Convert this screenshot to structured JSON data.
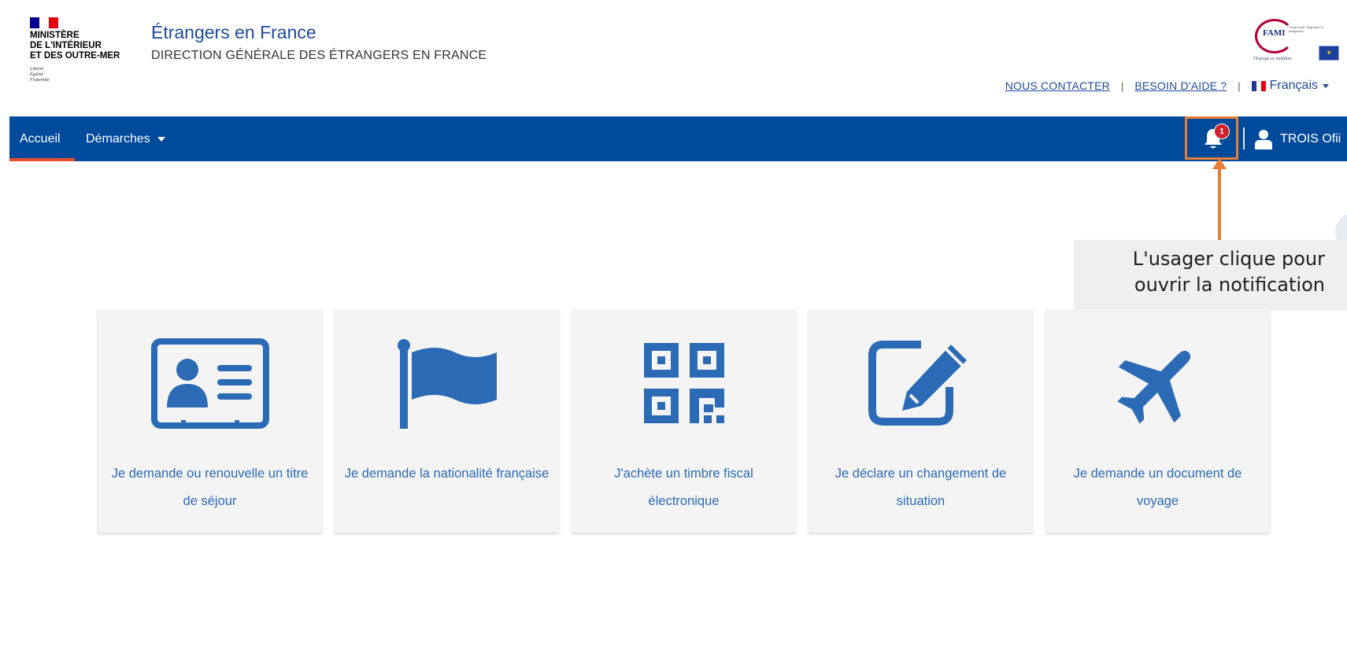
{
  "header": {
    "ministry": "MINISTÈRE\nDE L'INTÉRIEUR\nET DES OUTRE-MER",
    "motto": "Liberté\nÉgalité\nFraternité",
    "site_title": "Étrangers en France",
    "site_subtitle": "DIRECTION GÉNÉRALE DES ÉTRANGERS EN FRANCE",
    "fami": {
      "name": "FAMI",
      "desc": "Fonds Asile, Migration et Intégration",
      "tagline": "l'Europe se mobilise"
    },
    "links": {
      "contact": "NOUS CONTACTER",
      "help": "BESOIN D'AIDE ?",
      "separator": "|"
    },
    "language": "Français"
  },
  "nav": {
    "home": "Accueil",
    "procedures": "Démarches",
    "notification_count": "1",
    "user": "TROIS Ofii"
  },
  "callout": {
    "text": "L'usager clique pour\nouvrir la notification"
  },
  "cards": [
    {
      "icon": "id-card-icon",
      "label": "Je demande ou renouvelle un titre de séjour"
    },
    {
      "icon": "flag-icon",
      "label": "Je demande la nationalité française"
    },
    {
      "icon": "qr-code-icon",
      "label": "J'achète un timbre fiscal électronique"
    },
    {
      "icon": "edit-icon",
      "label": "Je déclare un changement de situation"
    },
    {
      "icon": "plane-icon",
      "label": "Je demande un document de voyage"
    }
  ],
  "colors": {
    "navbar": "#004a9c",
    "accent_orange": "#e87e34",
    "card_icon": "#2b6ab5",
    "active_underline": "#e64c2b",
    "badge": "#d0222b"
  }
}
